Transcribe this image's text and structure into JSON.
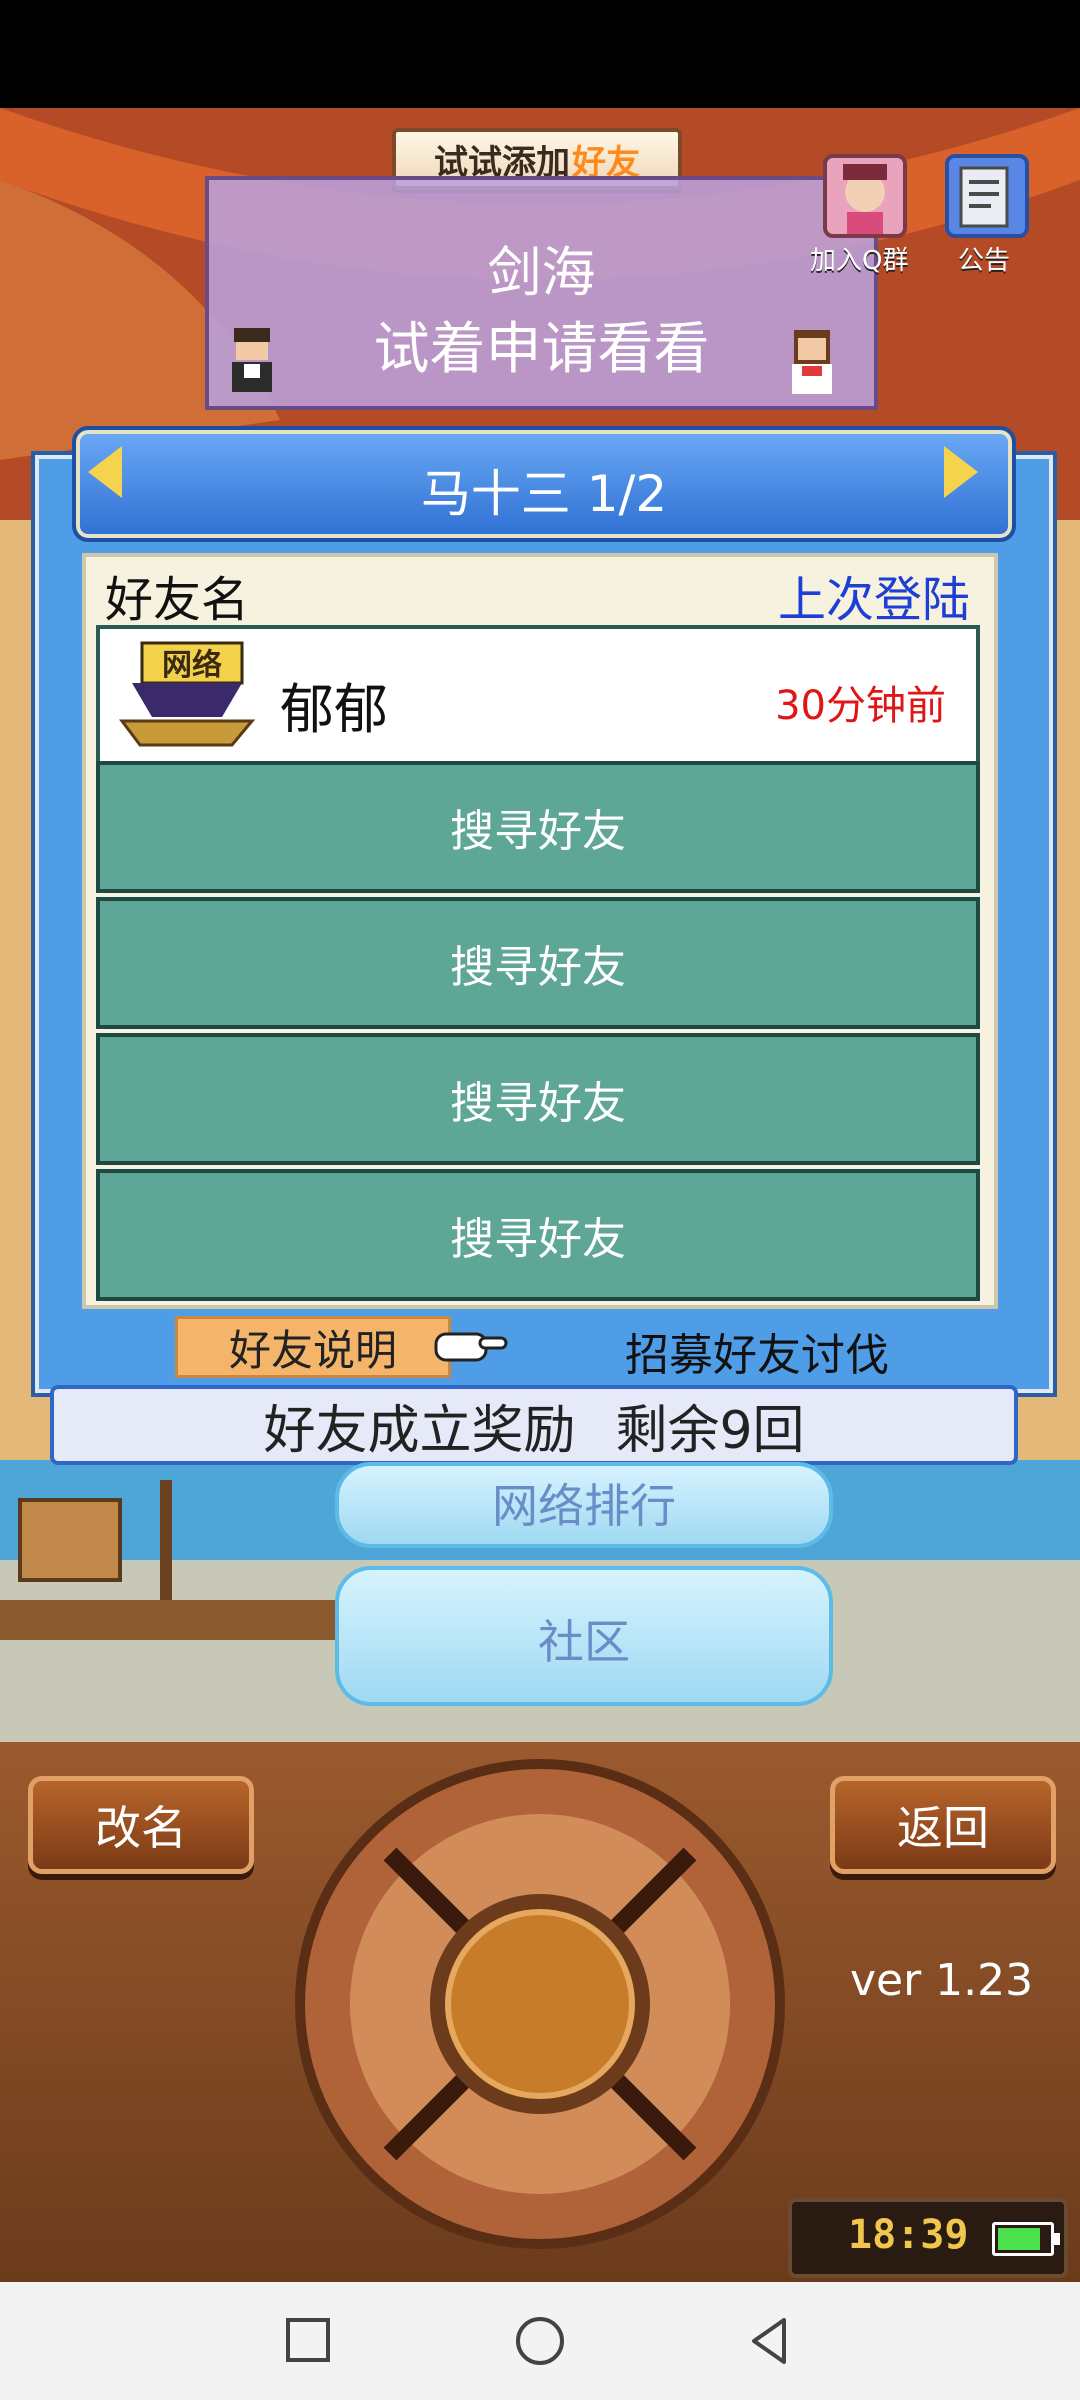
{
  "top_banner": {
    "text_prefix": "试试添加",
    "text_highlight": "好友"
  },
  "top_card": {
    "name": "剑海",
    "message": "试着申请看看"
  },
  "corner": {
    "qq_group_label": "加入Q群",
    "notice_label": "公告"
  },
  "friend_panel": {
    "title": "马十三 1/2",
    "column_name": "好友名",
    "column_last_login": "上次登陆",
    "friends": [
      {
        "badge": "网络",
        "name": "郁郁",
        "last_login": "30分钟前"
      }
    ],
    "empty_slot_label": "搜寻好友",
    "explain_label": "好友说明",
    "recruit_label": "招募好友讨伐"
  },
  "reward": {
    "label": "好友成立奖励",
    "remaining": "剩余9回"
  },
  "scene_buttons": {
    "upper_label": "网络排行",
    "community_label": "社区"
  },
  "bottom": {
    "rename_label": "改名",
    "back_label": "返回",
    "version": "ver 1.23"
  },
  "status": {
    "time": "18:39"
  },
  "colors": {
    "panel_blue": "#4f9de6",
    "slot_teal": "#5ea796",
    "time_red": "#e01515"
  }
}
